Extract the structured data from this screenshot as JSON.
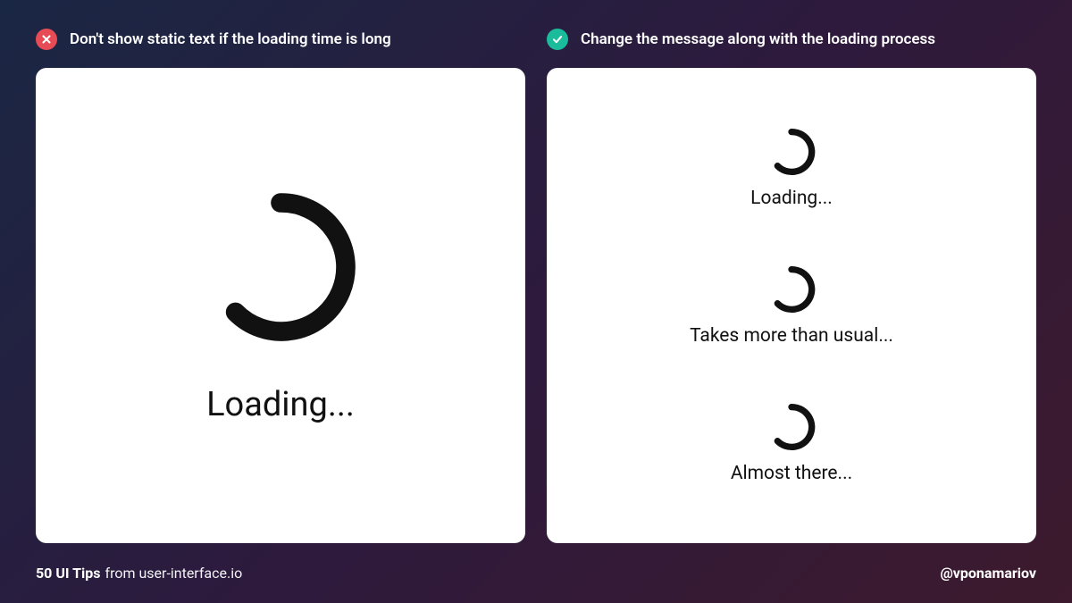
{
  "headers": {
    "dont": "Don't show static text if the loading time is long",
    "do": "Change the message along with the loading process"
  },
  "left_card": {
    "loading_text": "Loading..."
  },
  "right_card": {
    "states": [
      {
        "text": "Loading..."
      },
      {
        "text": "Takes more than usual..."
      },
      {
        "text": "Almost there..."
      }
    ]
  },
  "footer": {
    "bold": "50 UI Tips",
    "light": "from user-interface.io",
    "handle": "@vponamariov"
  }
}
